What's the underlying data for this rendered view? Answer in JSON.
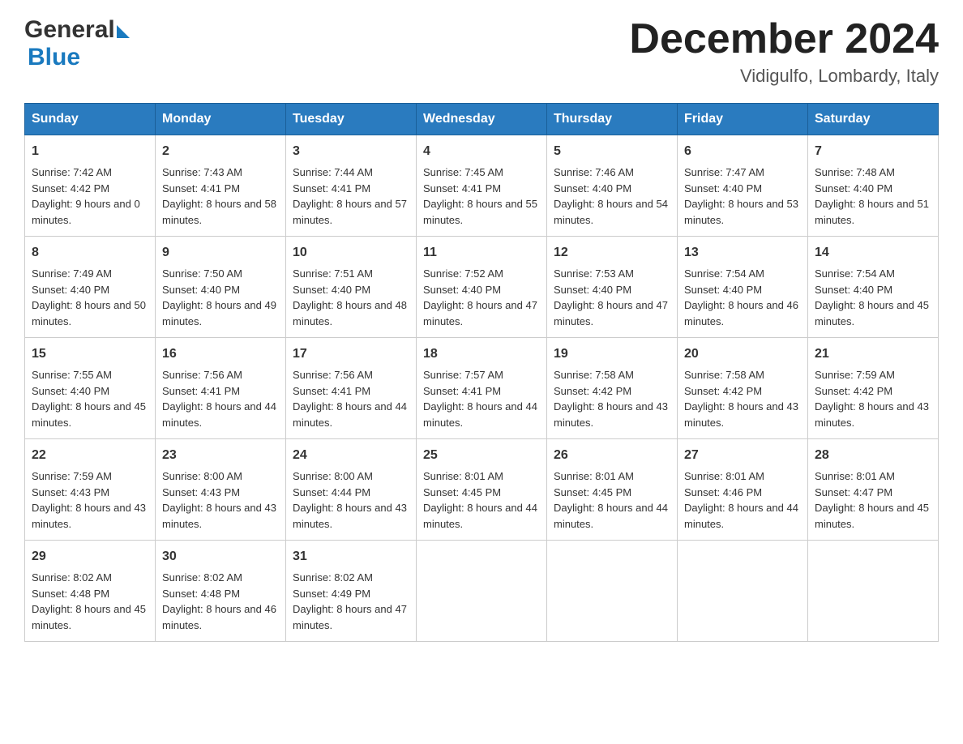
{
  "header": {
    "logo_general": "General",
    "logo_blue": "Blue",
    "month_title": "December 2024",
    "location": "Vidigulfo, Lombardy, Italy"
  },
  "days_of_week": [
    "Sunday",
    "Monday",
    "Tuesday",
    "Wednesday",
    "Thursday",
    "Friday",
    "Saturday"
  ],
  "weeks": [
    [
      {
        "day": "1",
        "sunrise": "7:42 AM",
        "sunset": "4:42 PM",
        "daylight": "9 hours and 0 minutes."
      },
      {
        "day": "2",
        "sunrise": "7:43 AM",
        "sunset": "4:41 PM",
        "daylight": "8 hours and 58 minutes."
      },
      {
        "day": "3",
        "sunrise": "7:44 AM",
        "sunset": "4:41 PM",
        "daylight": "8 hours and 57 minutes."
      },
      {
        "day": "4",
        "sunrise": "7:45 AM",
        "sunset": "4:41 PM",
        "daylight": "8 hours and 55 minutes."
      },
      {
        "day": "5",
        "sunrise": "7:46 AM",
        "sunset": "4:40 PM",
        "daylight": "8 hours and 54 minutes."
      },
      {
        "day": "6",
        "sunrise": "7:47 AM",
        "sunset": "4:40 PM",
        "daylight": "8 hours and 53 minutes."
      },
      {
        "day": "7",
        "sunrise": "7:48 AM",
        "sunset": "4:40 PM",
        "daylight": "8 hours and 51 minutes."
      }
    ],
    [
      {
        "day": "8",
        "sunrise": "7:49 AM",
        "sunset": "4:40 PM",
        "daylight": "8 hours and 50 minutes."
      },
      {
        "day": "9",
        "sunrise": "7:50 AM",
        "sunset": "4:40 PM",
        "daylight": "8 hours and 49 minutes."
      },
      {
        "day": "10",
        "sunrise": "7:51 AM",
        "sunset": "4:40 PM",
        "daylight": "8 hours and 48 minutes."
      },
      {
        "day": "11",
        "sunrise": "7:52 AM",
        "sunset": "4:40 PM",
        "daylight": "8 hours and 47 minutes."
      },
      {
        "day": "12",
        "sunrise": "7:53 AM",
        "sunset": "4:40 PM",
        "daylight": "8 hours and 47 minutes."
      },
      {
        "day": "13",
        "sunrise": "7:54 AM",
        "sunset": "4:40 PM",
        "daylight": "8 hours and 46 minutes."
      },
      {
        "day": "14",
        "sunrise": "7:54 AM",
        "sunset": "4:40 PM",
        "daylight": "8 hours and 45 minutes."
      }
    ],
    [
      {
        "day": "15",
        "sunrise": "7:55 AM",
        "sunset": "4:40 PM",
        "daylight": "8 hours and 45 minutes."
      },
      {
        "day": "16",
        "sunrise": "7:56 AM",
        "sunset": "4:41 PM",
        "daylight": "8 hours and 44 minutes."
      },
      {
        "day": "17",
        "sunrise": "7:56 AM",
        "sunset": "4:41 PM",
        "daylight": "8 hours and 44 minutes."
      },
      {
        "day": "18",
        "sunrise": "7:57 AM",
        "sunset": "4:41 PM",
        "daylight": "8 hours and 44 minutes."
      },
      {
        "day": "19",
        "sunrise": "7:58 AM",
        "sunset": "4:42 PM",
        "daylight": "8 hours and 43 minutes."
      },
      {
        "day": "20",
        "sunrise": "7:58 AM",
        "sunset": "4:42 PM",
        "daylight": "8 hours and 43 minutes."
      },
      {
        "day": "21",
        "sunrise": "7:59 AM",
        "sunset": "4:42 PM",
        "daylight": "8 hours and 43 minutes."
      }
    ],
    [
      {
        "day": "22",
        "sunrise": "7:59 AM",
        "sunset": "4:43 PM",
        "daylight": "8 hours and 43 minutes."
      },
      {
        "day": "23",
        "sunrise": "8:00 AM",
        "sunset": "4:43 PM",
        "daylight": "8 hours and 43 minutes."
      },
      {
        "day": "24",
        "sunrise": "8:00 AM",
        "sunset": "4:44 PM",
        "daylight": "8 hours and 43 minutes."
      },
      {
        "day": "25",
        "sunrise": "8:01 AM",
        "sunset": "4:45 PM",
        "daylight": "8 hours and 44 minutes."
      },
      {
        "day": "26",
        "sunrise": "8:01 AM",
        "sunset": "4:45 PM",
        "daylight": "8 hours and 44 minutes."
      },
      {
        "day": "27",
        "sunrise": "8:01 AM",
        "sunset": "4:46 PM",
        "daylight": "8 hours and 44 minutes."
      },
      {
        "day": "28",
        "sunrise": "8:01 AM",
        "sunset": "4:47 PM",
        "daylight": "8 hours and 45 minutes."
      }
    ],
    [
      {
        "day": "29",
        "sunrise": "8:02 AM",
        "sunset": "4:48 PM",
        "daylight": "8 hours and 45 minutes."
      },
      {
        "day": "30",
        "sunrise": "8:02 AM",
        "sunset": "4:48 PM",
        "daylight": "8 hours and 46 minutes."
      },
      {
        "day": "31",
        "sunrise": "8:02 AM",
        "sunset": "4:49 PM",
        "daylight": "8 hours and 47 minutes."
      },
      null,
      null,
      null,
      null
    ]
  ],
  "labels": {
    "sunrise": "Sunrise:",
    "sunset": "Sunset:",
    "daylight": "Daylight:"
  }
}
